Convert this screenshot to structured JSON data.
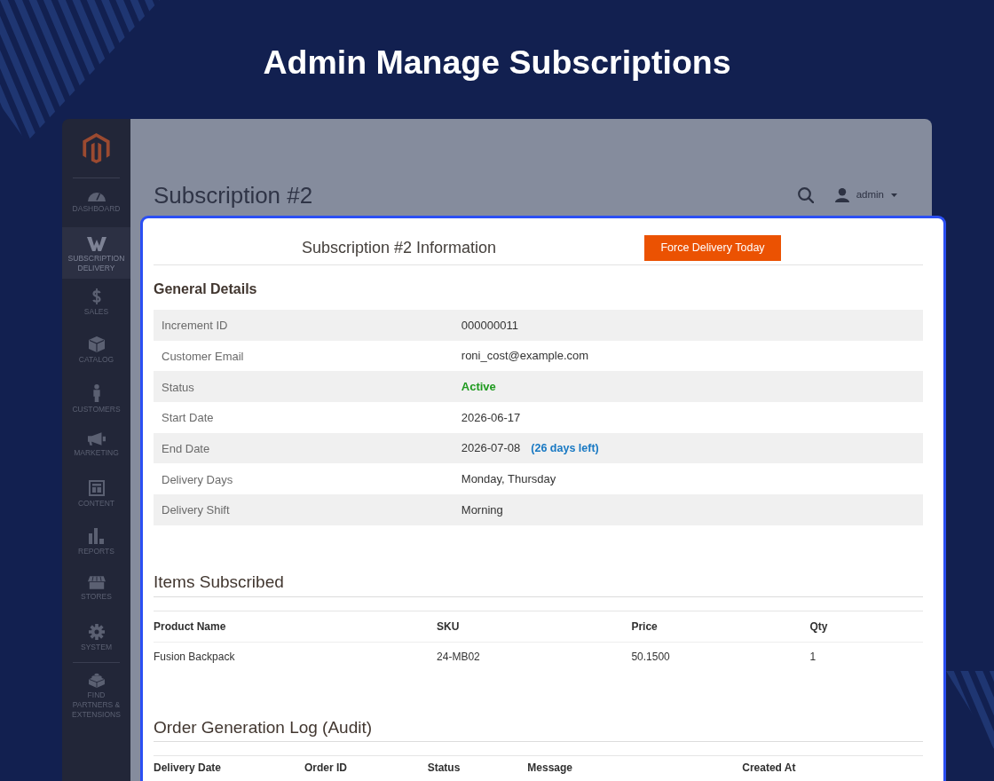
{
  "banner": {
    "title": "Admin Manage Subscriptions"
  },
  "sidebar": {
    "items": [
      {
        "label": "DASHBOARD",
        "selected": false
      },
      {
        "label": "SUBSCRIPTION DELIVERY",
        "selected": true
      },
      {
        "label": "SALES",
        "selected": false
      },
      {
        "label": "CATALOG",
        "selected": false
      },
      {
        "label": "CUSTOMERS",
        "selected": false
      },
      {
        "label": "MARKETING",
        "selected": false
      },
      {
        "label": "CONTENT",
        "selected": false
      },
      {
        "label": "REPORTS",
        "selected": false
      },
      {
        "label": "STORES",
        "selected": false
      },
      {
        "label": "SYSTEM",
        "selected": false
      },
      {
        "label": "FIND PARTNERS & EXTENSIONS",
        "selected": false
      }
    ]
  },
  "page_header": {
    "title": "Subscription #2",
    "user": "admin"
  },
  "panel": {
    "title": "Subscription #2 Information",
    "action": "Force Delivery Today",
    "general_details": {
      "title": "General Details",
      "rows": [
        {
          "label": "Increment ID",
          "value": "000000011",
          "kind": "text"
        },
        {
          "label": "Customer Email",
          "value": "roni_cost@example.com",
          "kind": "text"
        },
        {
          "label": "Status",
          "value": "Active",
          "kind": "status"
        },
        {
          "label": "Start Date",
          "value": "2026-06-17",
          "kind": "text"
        },
        {
          "label": "End Date",
          "value": "2026-07-08",
          "note": "(26 days left)",
          "kind": "text"
        },
        {
          "label": "Delivery Days",
          "value": "Monday, Thursday",
          "kind": "text"
        },
        {
          "label": "Delivery Shift",
          "value": "Morning",
          "kind": "text"
        }
      ]
    },
    "items_subscribed": {
      "title": "Items Subscribed",
      "columns": [
        "Product Name",
        "SKU",
        "Price",
        "Qty"
      ],
      "rows": [
        [
          "Fusion Backpack",
          "24-MB02",
          "50.1500",
          "1"
        ]
      ]
    },
    "order_log": {
      "title": "Order Generation Log (Audit)",
      "columns": [
        "Delivery Date",
        "Order ID",
        "Status",
        "Message",
        "Created At"
      ]
    }
  }
}
